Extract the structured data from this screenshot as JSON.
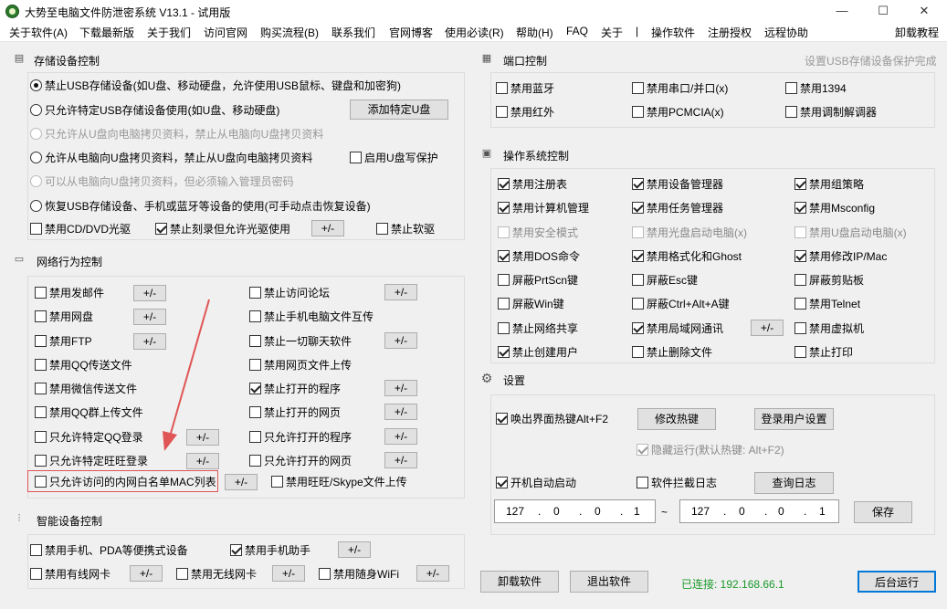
{
  "window": {
    "title": "大势至电脑文件防泄密系统 V13.1 - 试用版",
    "min": "—",
    "max": "☐",
    "close": "✕"
  },
  "menu": [
    "关于软件(A)",
    "下载最新版",
    "关于我们",
    "访问官网",
    "购买流程(B)",
    "联系我们",
    "官网博客",
    "使用必读(R)",
    "帮助(H)",
    "FAQ",
    "关于",
    "|",
    "操作软件",
    "注册授权",
    "远程协助",
    "卸载教程"
  ],
  "storage": {
    "title": "存储设备控制",
    "r1": "禁止USB存储设备(如U盘、移动硬盘，允许使用USB鼠标、键盘和加密狗)",
    "r2": "只允许特定USB存储设备使用(如U盘、移动硬盘)",
    "add_btn": "添加特定U盘",
    "r3": "只允许从U盘向电脑拷贝资料，禁止从电脑向U盘拷贝资料",
    "r4": "允许从电脑向U盘拷贝资料，禁止从U盘向电脑拷贝资料",
    "cb_write": "启用U盘写保护",
    "r5": "可以从电脑向U盘拷贝资料，但必须输入管理员密码",
    "r6": "恢复USB存储设备、手机或蓝牙等设备的使用(可手动点击恢复设备)",
    "cd": "禁用CD/DVD光驱",
    "burn": "禁止刻录但允许光驱使用",
    "pm": "+/-",
    "floppy": "禁止软驱"
  },
  "network": {
    "title": "网络行为控制",
    "left": [
      "禁用发邮件",
      "禁用网盘",
      "禁用FTP",
      "禁用QQ传送文件",
      "禁用微信传送文件",
      "禁用QQ群上传文件",
      "只允许特定QQ登录",
      "只允许特定旺旺登录",
      "只允许访问的内网白名单MAC列表"
    ],
    "right": [
      "禁止访问论坛",
      "禁止手机电脑文件互传",
      "禁止一切聊天软件",
      "禁用网页文件上传",
      "禁止打开的程序",
      "禁止打开的网页",
      "只允许打开的程序",
      "只允许打开的网页",
      "禁用旺旺/Skype文件上传"
    ],
    "pm": "+/-"
  },
  "smart": {
    "title": "智能设备控制",
    "pda": "禁用手机、PDA等便携式设备",
    "assistant": "禁用手机助手",
    "wired": "禁用有线网卡",
    "wireless": "禁用无线网卡",
    "wifi": "禁用随身WiFi",
    "pm": "+/-"
  },
  "port": {
    "title": "端口控制",
    "right_note": "设置USB存储设备保护完成",
    "items": [
      "禁用蓝牙",
      "禁用串口/并口(x)",
      "禁用1394",
      "禁用红外",
      "禁用PCMCIA(x)",
      "禁用调制解调器"
    ]
  },
  "os": {
    "title": "操作系统控制",
    "items": [
      "禁用注册表",
      "禁用设备管理器",
      "禁用组策略",
      "禁用计算机管理",
      "禁用任务管理器",
      "禁用Msconfig",
      "禁用安全模式",
      "禁用光盘启动电脑(x)",
      "禁用U盘启动电脑(x)",
      "禁用DOS命令",
      "禁用格式化和Ghost",
      "禁用修改IP/Mac",
      "屏蔽PrtScn键",
      "屏蔽Esc键",
      "屏蔽剪贴板",
      "屏蔽Win键",
      "屏蔽Ctrl+Alt+A键",
      "禁用Telnet",
      "禁止网络共享",
      "禁用局域网通讯",
      "禁用虚拟机",
      "禁止创建用户",
      "禁止删除文件",
      "禁止打印"
    ],
    "pm": "+/-"
  },
  "settings": {
    "title": "设置",
    "hotkey": "唤出界面热键Alt+F2",
    "change_hotkey": "修改热键",
    "login_user": "登录用户设置",
    "hidden": "隐藏运行(默认热键: Alt+F2)",
    "autostart": "开机自动启动",
    "intercept_log": "软件拦截日志",
    "query_log": "查询日志",
    "ip_from": [
      "127",
      "0",
      "0",
      "1"
    ],
    "tilde": "~",
    "ip_to": [
      "127",
      "0",
      "0",
      "1"
    ],
    "save": "保存"
  },
  "bottom": {
    "uninstall": "卸载软件",
    "exit": "退出软件",
    "status": "已连接: 192.168.66.1",
    "background": "后台运行"
  },
  "colors": {
    "accent_red": "#e05555",
    "status_green": "#1a9a2a"
  }
}
